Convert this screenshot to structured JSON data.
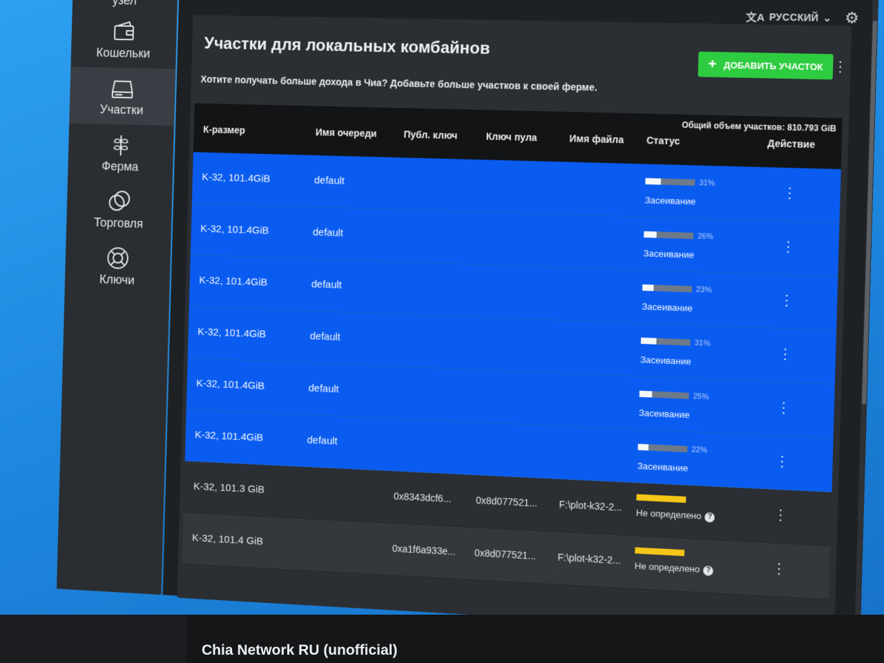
{
  "sidebar": {
    "top_label": "узел",
    "items": [
      {
        "label": "Кошельки",
        "icon": "wallet-icon",
        "active": false
      },
      {
        "label": "Участки",
        "icon": "harddrive-icon",
        "active": true
      },
      {
        "label": "Ферма",
        "icon": "sprout-icon",
        "active": false
      },
      {
        "label": "Торговля",
        "icon": "trade-icon",
        "active": false
      },
      {
        "label": "Ключи",
        "icon": "lifebuoy-icon",
        "active": false
      }
    ]
  },
  "topbar": {
    "language": "РУССКИЙ",
    "language_icon": "translate-icon",
    "settings_icon": "gear-icon"
  },
  "page": {
    "title": "Участки для локальных комбайнов",
    "subtitle": "Хотите получать больше дохода в Чиа? Добавьте больше участков к своей ферме.",
    "add_button": "ДОБАВИТЬ УЧАСТОК",
    "total": "Общий объем участков: 810.793 GiB"
  },
  "table": {
    "headers": [
      "К-размер",
      "Имя очереди",
      "Публ. ключ",
      "Ключ пула",
      "Имя файла",
      "Статус",
      "Действие"
    ],
    "rows": [
      {
        "size": "K-32, 101.4GiB",
        "queue": "default",
        "pubkey": "",
        "poolkey": "",
        "filename": "",
        "status": "Засеивание",
        "progress": "31%",
        "progress_value": 31,
        "type": "plotting"
      },
      {
        "size": "K-32, 101.4GiB",
        "queue": "default",
        "pubkey": "",
        "poolkey": "",
        "filename": "",
        "status": "Засеивание",
        "progress": "26%",
        "progress_value": 26,
        "type": "plotting"
      },
      {
        "size": "K-32, 101.4GiB",
        "queue": "default",
        "pubkey": "",
        "poolkey": "",
        "filename": "",
        "status": "Засеивание",
        "progress": "23%",
        "progress_value": 23,
        "type": "plotting"
      },
      {
        "size": "K-32, 101.4GiB",
        "queue": "default",
        "pubkey": "",
        "poolkey": "",
        "filename": "",
        "status": "Засеивание",
        "progress": "31%",
        "progress_value": 31,
        "type": "plotting"
      },
      {
        "size": "K-32, 101.4GiB",
        "queue": "default",
        "pubkey": "",
        "poolkey": "",
        "filename": "",
        "status": "Засеивание",
        "progress": "25%",
        "progress_value": 25,
        "type": "plotting"
      },
      {
        "size": "K-32, 101.4GiB",
        "queue": "default",
        "pubkey": "",
        "poolkey": "",
        "filename": "",
        "status": "Засеивание",
        "progress": "22%",
        "progress_value": 22,
        "type": "plotting"
      },
      {
        "size": "K-32, 101.3 GiB",
        "queue": "",
        "pubkey": "0x8343dcf6...",
        "poolkey": "0x8d077521...",
        "filename": "F:\\plot-k32-2...",
        "status": "Не определено",
        "progress": "",
        "type": "done"
      },
      {
        "size": "K-32, 101.4 GiB",
        "queue": "",
        "pubkey": "0xa1f6a933e...",
        "poolkey": "0x8d077521...",
        "filename": "F:\\plot-k32-2...",
        "status": "Не определено",
        "progress": "",
        "type": "done"
      }
    ]
  },
  "taskbar": {
    "title": "Chia Network RU (unofficial)"
  },
  "colors": {
    "selected_row": "#0a5cf0",
    "add_button": "#2ecc40",
    "warn_bar": "#f5c518"
  }
}
